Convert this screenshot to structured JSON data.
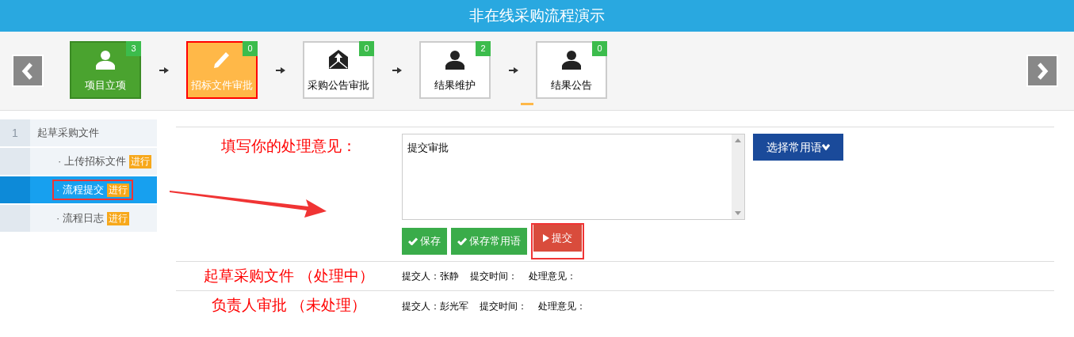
{
  "header": {
    "title": "非在线采购流程演示"
  },
  "steps": [
    {
      "label": "项目立项",
      "count": "3",
      "done": true,
      "selected": false
    },
    {
      "label": "招标文件审批",
      "count": "0",
      "done": false,
      "selected": true
    },
    {
      "label": "采购公告审批",
      "count": "0",
      "done": false,
      "selected": false
    },
    {
      "label": "结果维护",
      "count": "2",
      "done": false,
      "selected": false
    },
    {
      "label": "结果公告",
      "count": "0",
      "done": false,
      "selected": false
    }
  ],
  "sidebar": {
    "number": "1",
    "title": "起草采购文件",
    "items": [
      {
        "label": "· 上传招标文件",
        "badge": "进行",
        "selected": false,
        "highlighted": false
      },
      {
        "label": "· 流程提交",
        "badge": "进行",
        "selected": true,
        "highlighted": true
      },
      {
        "label": "· 流程日志",
        "badge": "进行",
        "selected": false,
        "highlighted": false
      }
    ]
  },
  "form": {
    "label": "填写你的处理意见：",
    "opinion": "提交审批",
    "phrase_button": "选择常用语",
    "buttons": [
      {
        "label": "保存",
        "kind": "save",
        "highlighted": false
      },
      {
        "label": "保存常用语",
        "kind": "save",
        "highlighted": false
      },
      {
        "label": "提交",
        "kind": "submit",
        "highlighted": true
      }
    ]
  },
  "history": [
    {
      "title": "起草采购文件 （处理中）",
      "submitter": "提交人：张静",
      "time": "提交时间：",
      "opinion": "处理意见："
    },
    {
      "title": "负责人审批 （未处理）",
      "submitter": "提交人：彭光军",
      "time": "提交时间：",
      "opinion": "处理意见："
    }
  ]
}
